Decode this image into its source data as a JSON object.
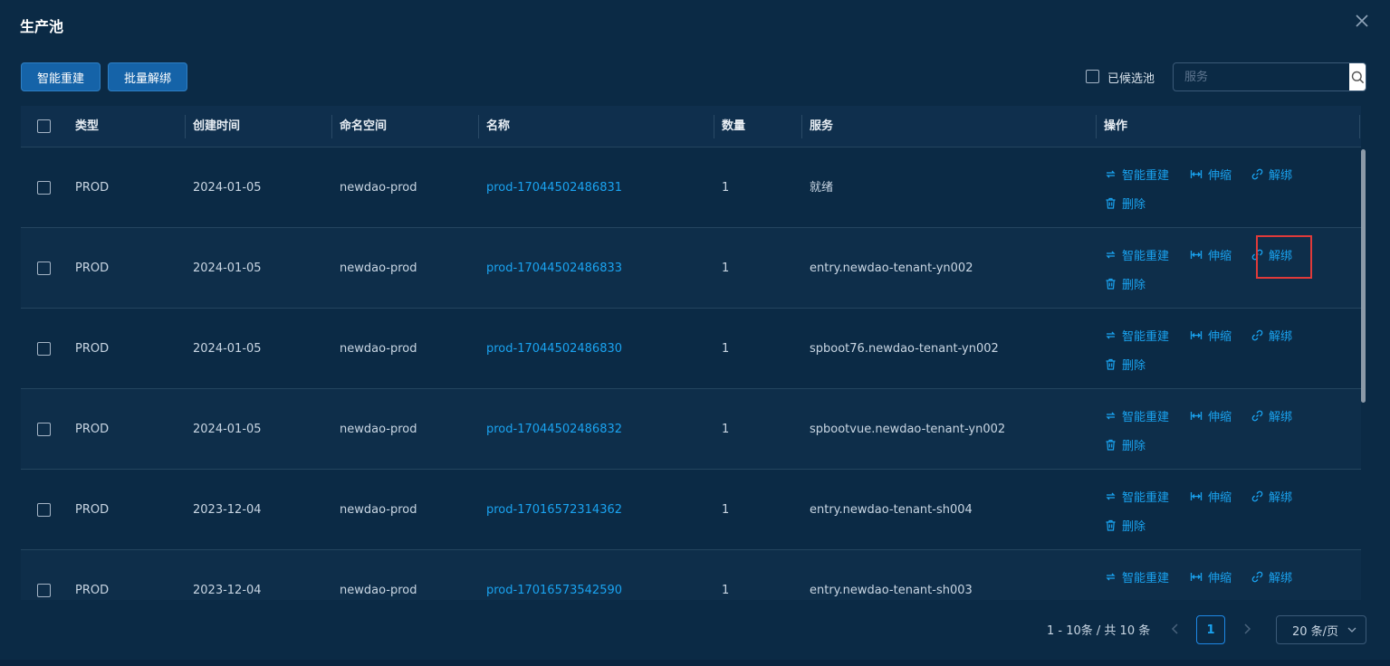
{
  "dialog": {
    "title": "生产池"
  },
  "toolbar": {
    "smart_rebuild_label": "智能重建",
    "batch_unbind_label": "批量解绑",
    "candidate_pool_label": "已候选池",
    "search_placeholder": "服务"
  },
  "table": {
    "headers": {
      "type": "类型",
      "created": "创建时间",
      "namespace": "命名空间",
      "name": "名称",
      "count": "数量",
      "service": "服务",
      "ops": "操作"
    },
    "op_labels": {
      "rebuild": "智能重建",
      "scale": "伸缩",
      "unbind": "解绑",
      "delete": "删除"
    },
    "rows": [
      {
        "type": "PROD",
        "created": "2024-01-05",
        "namespace": "newdao-prod",
        "name": "prod-17044502486831",
        "count": "1",
        "service": "就绪"
      },
      {
        "type": "PROD",
        "created": "2024-01-05",
        "namespace": "newdao-prod",
        "name": "prod-17044502486833",
        "count": "1",
        "service": "entry.newdao-tenant-yn002"
      },
      {
        "type": "PROD",
        "created": "2024-01-05",
        "namespace": "newdao-prod",
        "name": "prod-17044502486830",
        "count": "1",
        "service": "spboot76.newdao-tenant-yn002"
      },
      {
        "type": "PROD",
        "created": "2024-01-05",
        "namespace": "newdao-prod",
        "name": "prod-17044502486832",
        "count": "1",
        "service": "spbootvue.newdao-tenant-yn002"
      },
      {
        "type": "PROD",
        "created": "2023-12-04",
        "namespace": "newdao-prod",
        "name": "prod-17016572314362",
        "count": "1",
        "service": "entry.newdao-tenant-sh004"
      },
      {
        "type": "PROD",
        "created": "2023-12-04",
        "namespace": "newdao-prod",
        "name": "prod-17016573542590",
        "count": "1",
        "service": "entry.newdao-tenant-sh003"
      }
    ]
  },
  "pagination": {
    "total_text": "1 - 10条 / 共 10 条",
    "current_page": "1",
    "page_size_text": "20 条/页"
  },
  "colors": {
    "background": "#0b2a45",
    "link": "#1aa3f0",
    "primary_button": "#1563a8",
    "highlight": "#e03a3a"
  }
}
